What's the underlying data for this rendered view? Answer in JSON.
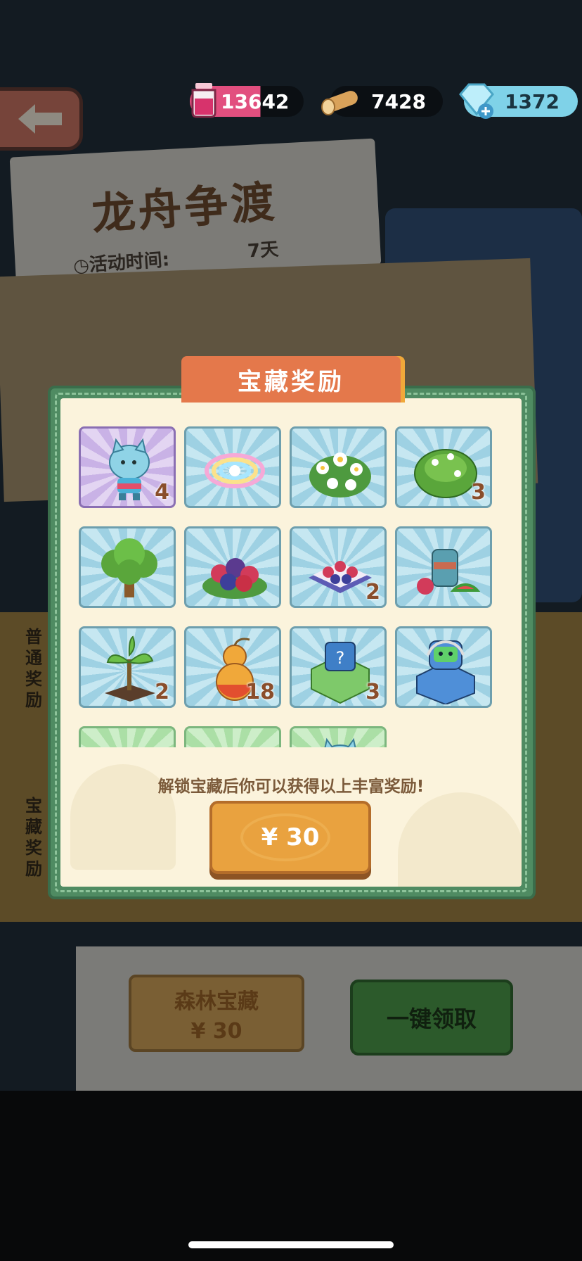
{
  "top_bar": {
    "juice": "13642",
    "wood": "7428",
    "gems": "1372"
  },
  "background": {
    "event_title": "龙舟争渡",
    "time_label": "活动时间:",
    "time_value": "7天",
    "side_label_normal": "普通奖励",
    "side_label_treasure": "宝藏奖励",
    "forest_title": "森林宝藏",
    "forest_price": "¥ 30",
    "claim_all": "一键领取"
  },
  "modal": {
    "title": "宝藏奖励",
    "unlock_text": "解锁宝藏后你可以获得以上丰富奖励!",
    "price_label": "¥ 30",
    "rewards": [
      {
        "item": "cat-character-icon",
        "count": "4",
        "style": "purple"
      },
      {
        "item": "rainbow-orb-icon",
        "count": "",
        "style": "blue"
      },
      {
        "item": "flower-bush-icon",
        "count": "",
        "style": "blue"
      },
      {
        "item": "green-shrub-icon",
        "count": "3",
        "style": "blue"
      },
      {
        "item": "fruit-tree-icon",
        "count": "",
        "style": "blue"
      },
      {
        "item": "berry-pile-icon",
        "count": "",
        "style": "blue"
      },
      {
        "item": "berry-tart-icon",
        "count": "2",
        "style": "blue"
      },
      {
        "item": "fruit-jar-icon",
        "count": "",
        "style": "blue"
      },
      {
        "item": "sapling-icon",
        "count": "2",
        "style": "blue"
      },
      {
        "item": "gourd-icon",
        "count": "18",
        "style": "blue"
      },
      {
        "item": "mystery-box-icon",
        "count": "3",
        "style": "blue"
      },
      {
        "item": "robot-blind-box-icon",
        "count": "",
        "style": "blue"
      },
      {
        "item": "bubble-orb-icon",
        "count": "",
        "style": "green"
      },
      {
        "item": "ticket-icon",
        "count": "",
        "style": "green"
      },
      {
        "item": "cat-character-icon",
        "count": "",
        "style": "green"
      }
    ]
  },
  "colors": {
    "modal_frame": "#4f8b62",
    "ribbon": "#e4784b",
    "price_button": "#e9a23f",
    "panel": "#fbf3dc"
  }
}
